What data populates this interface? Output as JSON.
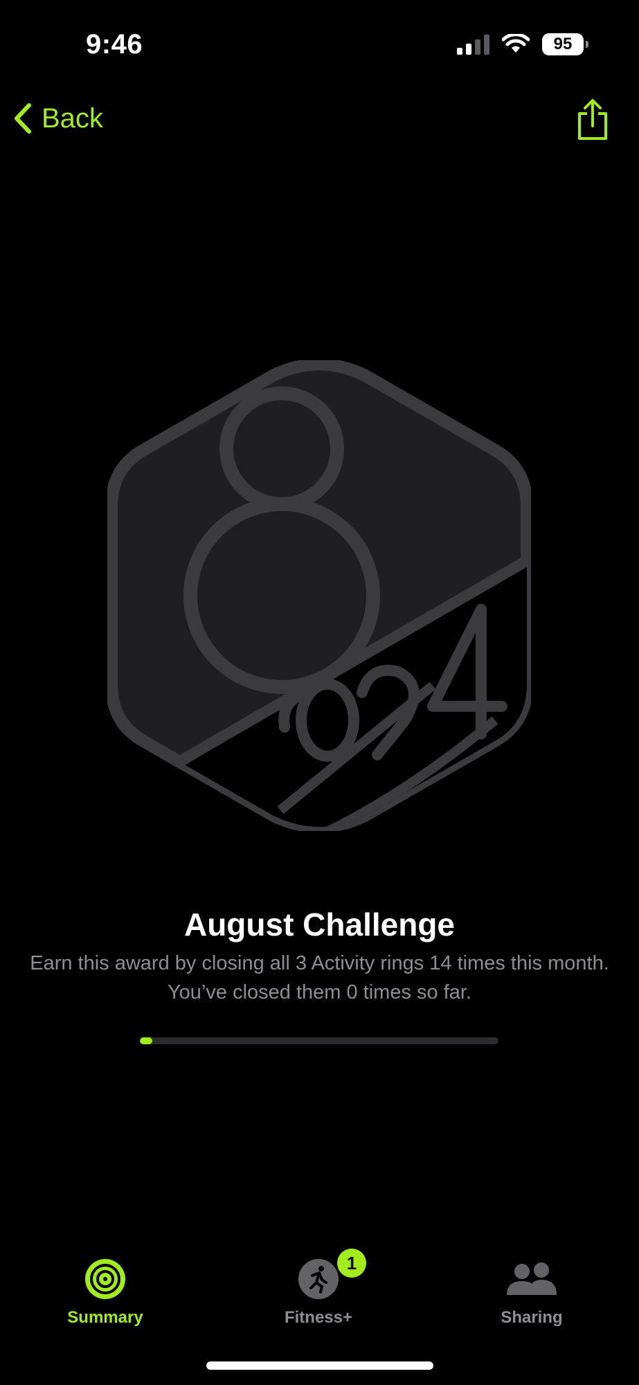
{
  "status_bar": {
    "time": "9:46",
    "battery": "95"
  },
  "nav": {
    "back_label": "Back",
    "share_icon": "share-icon"
  },
  "award": {
    "title": "August Challenge",
    "description": "Earn this award by closing all 3 Activity rings 14 times this month. You’ve closed them 0 times so far.",
    "progress": 0
  },
  "tabs": [
    {
      "label": "Summary",
      "icon": "activity-rings-icon",
      "active": true
    },
    {
      "label": "Fitness+",
      "icon": "fitness-runner-icon",
      "badge": "1"
    },
    {
      "label": "Sharing",
      "icon": "people-icon"
    }
  ],
  "colors": {
    "accent": "#a3ec1b",
    "badge_fill": "#1f1f21",
    "badge_stroke": "#3b3b3d",
    "secondary_text": "#8e8e93"
  }
}
